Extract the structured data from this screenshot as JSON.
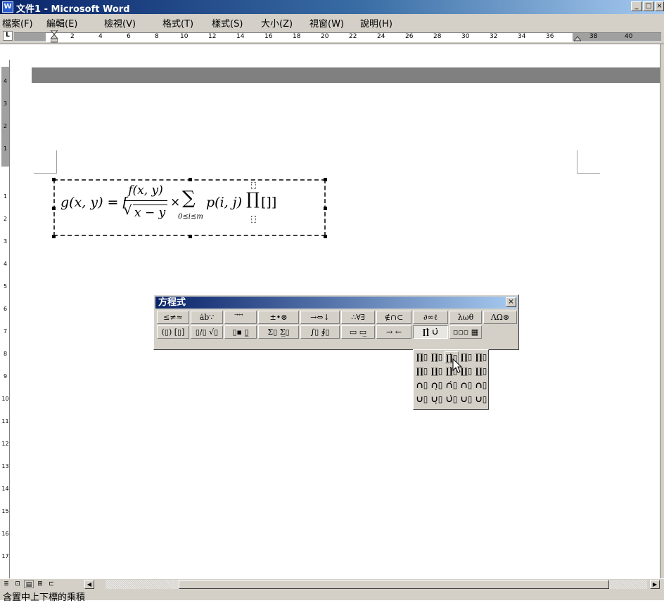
{
  "window": {
    "title": "文件1 - Microsoft Word",
    "app_icon": "W",
    "controls": {
      "minimize": "_",
      "maximize": "□",
      "close": "×"
    }
  },
  "menu": {
    "items": [
      "檔案(F)",
      "編輯(E)",
      "檢視(V)",
      "格式(T)",
      "樣式(S)",
      "大小(Z)",
      "視窗(W)",
      "說明(H)"
    ]
  },
  "ruler": {
    "tab_selector": "L",
    "horizontal_ticks": [
      "2",
      "4",
      "6",
      "8",
      "10",
      "12",
      "14",
      "16",
      "18",
      "20",
      "22",
      "24",
      "26",
      "28",
      "30",
      "32",
      "34",
      "36",
      "38",
      "40"
    ],
    "vertical_ticks": [
      "4",
      "3",
      "2",
      "1",
      "1",
      "2",
      "3",
      "4",
      "5",
      "6",
      "7",
      "8",
      "9",
      "10",
      "11",
      "12",
      "13",
      "14",
      "15",
      "16",
      "17"
    ]
  },
  "equation": {
    "lhs": "g(x, y) = [",
    "num": "f(x, y)",
    "den": "x − y",
    "times": "×",
    "sum_symbol": "∑",
    "sum_sub": "0≤i≤m",
    "term": "p(i, j)",
    "prod_symbol": "∏",
    "tail": "[]]"
  },
  "equation_toolbar": {
    "title": "方程式",
    "close": "×",
    "row1": [
      "≤≠≈",
      "ȧb∵",
      "⃗ ⃗ ⃗",
      "±•⊗",
      "→⇔↓",
      "∴∀∃",
      "∉∩⊂",
      "∂∞ℓ",
      "λωθ",
      "ΛΩ⊛"
    ],
    "row2": [
      "(▯) [▯]",
      "▯/▯ √▯",
      "▯▪ ▯̲",
      "Σ▯ Σ̲▯",
      "∫▯ ∮▯",
      "▭ ▭̲",
      "→ ←",
      "∏̇ ∪̇",
      "▫▫▫ ▦"
    ]
  },
  "palette": {
    "rows": [
      [
        "∏▯",
        "∏̣▯",
        "∏̇▯",
        "∏▯",
        "∏▯"
      ],
      [
        "∏▯",
        "∐▯",
        "∐̇▯",
        "∐▯",
        "∐▯"
      ],
      [
        "∩▯",
        "∩̣▯",
        "∩̇▯",
        "∩▯",
        "∩▯"
      ],
      [
        "∪▯",
        "∪̣▯",
        "∪̇▯",
        "∪▯",
        "∪▯"
      ]
    ]
  },
  "status": {
    "text": "含置中上下標的乘積"
  },
  "bottom_bar": {
    "view_buttons": [
      "≣",
      "⊡",
      "▤",
      "⊞",
      "⊏"
    ],
    "scroll_left": "◀",
    "scroll_right": "▶"
  }
}
